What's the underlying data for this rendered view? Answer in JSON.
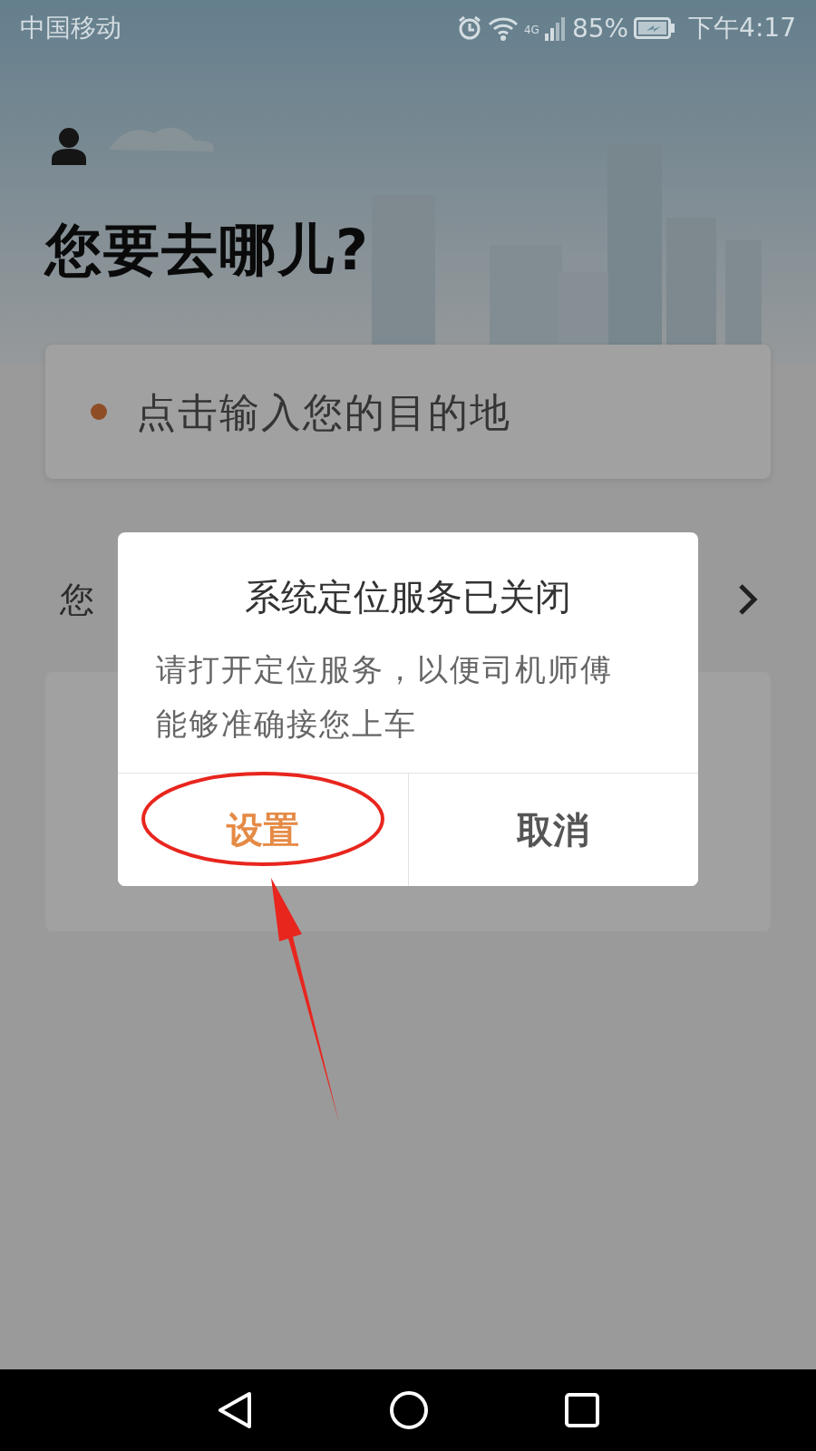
{
  "status_bar": {
    "carrier": "中国移动",
    "network": "4G",
    "battery": "85%",
    "time": "下午4:17"
  },
  "header": {
    "title": "您要去哪儿?"
  },
  "destination_field": {
    "placeholder": "点击输入您的目的地"
  },
  "section_row": {
    "label": "您"
  },
  "dialog": {
    "title": "系统定位服务已关闭",
    "message": "请打开定位服务，以便司机师傅能够准确接您上车",
    "buttons": [
      {
        "label": "设置",
        "kind": "primary"
      },
      {
        "label": "取消",
        "kind": "secondary"
      }
    ]
  }
}
